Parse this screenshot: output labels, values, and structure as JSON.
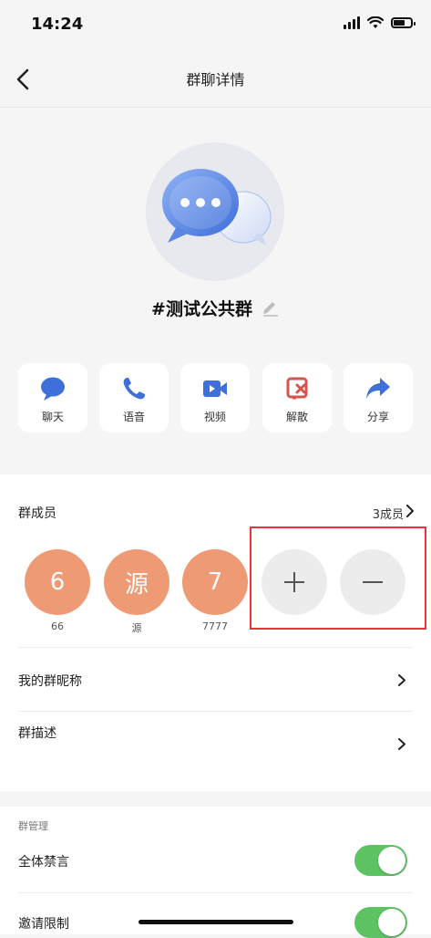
{
  "status_bar": {
    "time": "14:24"
  },
  "nav": {
    "title": "群聊详情"
  },
  "group": {
    "name": "#测试公共群"
  },
  "actions": [
    {
      "label": "聊天",
      "icon": "chat-bubble-icon"
    },
    {
      "label": "语音",
      "icon": "phone-icon"
    },
    {
      "label": "视频",
      "icon": "video-camera-icon"
    },
    {
      "label": "解散",
      "icon": "dissolve-icon"
    },
    {
      "label": "分享",
      "icon": "share-icon"
    }
  ],
  "members_section": {
    "title": "群成员",
    "count_label": "3成员",
    "members": [
      {
        "avatar_text": "6",
        "name": "66"
      },
      {
        "avatar_text": "源",
        "name": "源"
      },
      {
        "avatar_text": "7",
        "name": "7777"
      }
    ],
    "avatar_color": "#ee9a75"
  },
  "rows": {
    "nickname_label": "我的群昵称",
    "description_label": "群描述"
  },
  "management": {
    "title": "群管理",
    "mute_all_label": "全体禁言",
    "mute_all_on": true,
    "invite_limit_label": "邀请限制",
    "invite_limit_on": true
  },
  "colors": {
    "accent": "#3f6fd9",
    "toggle_on": "#5cc262",
    "highlight_box": "#e8343a"
  }
}
